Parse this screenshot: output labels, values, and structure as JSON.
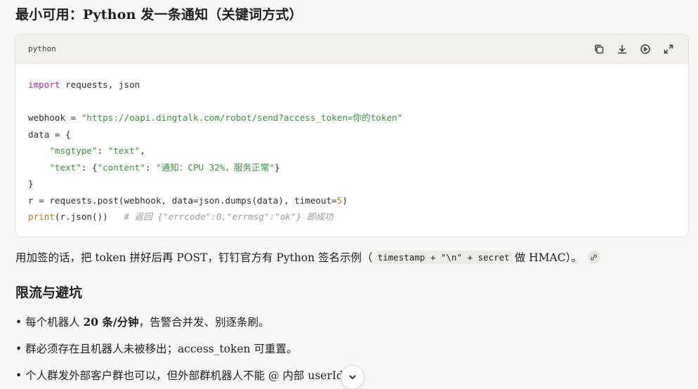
{
  "heading": "最小可用：Python 发一条通知（关键词方式）",
  "code_block": {
    "language": "python",
    "tools": [
      "copy-icon",
      "download-icon",
      "run-icon",
      "expand-icon"
    ],
    "lines": {
      "l1_kw": "import",
      "l1_rest": " requests, json",
      "l3_a": "webhook = ",
      "l3_str": "\"https://oapi.dingtalk.com/robot/send?access_token=你的token\"",
      "l4": "data = {",
      "l5_indent": "    ",
      "l5_key": "\"msgtype\"",
      "l5_colon": ": ",
      "l5_val": "\"text\"",
      "l5_end": ",",
      "l6_indent": "    ",
      "l6_key": "\"text\"",
      "l6_mid": ": {",
      "l6_key2": "\"content\"",
      "l6_colon": ": ",
      "l6_val": "\"通知：CPU 32%，服务正常\"",
      "l6_end": "}",
      "l7": "}",
      "l8_a": "r = requests.post(webhook, data=json.dumps(data), timeout=",
      "l8_num": "5",
      "l8_end": ")",
      "l9_fn": "print",
      "l9_rest": "(r.json())   ",
      "l9_cmt": "# 返回 {\"errcode\":0,\"errmsg\":\"ok\"} 即成功"
    }
  },
  "paragraph": {
    "before": "用加签的话，把 token 拼好后再 POST，钉钉官方有 Python 签名示例（",
    "code": "timestamp + \"\\n\" + secret",
    "after": "做 HMAC）。"
  },
  "subheading": "限流与避坑",
  "bullets": {
    "b1_pre": "• 每个机器人 ",
    "b1_bold": "20 条/分钟",
    "b1_post": "，告警合并发、别逐条刷。",
    "b2": "• 群必须存在且机器人未被移出；access_token 可重置。",
    "b3": "• 个人群发外部客户群也可以，但外部群机器人不能 @ 内部 userId"
  },
  "colors": {
    "background": "#f8f7f3",
    "keyword": "#a626a4",
    "string": "#3a8f3a",
    "number": "#c07a14",
    "comment": "#9a9a9a"
  }
}
